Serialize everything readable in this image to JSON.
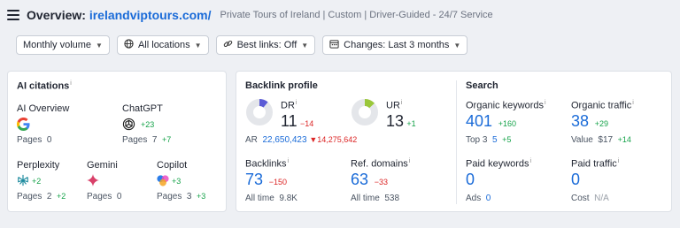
{
  "header": {
    "title_prefix": "Overview:",
    "domain": "irelandviptours.com/",
    "description": "Private Tours of Ireland | Custom | Driver-Guided - 24/7 Service"
  },
  "filters": [
    {
      "label": "Monthly volume",
      "icon": "none"
    },
    {
      "label": "All locations",
      "icon": "globe-icon"
    },
    {
      "label": "Best links: Off",
      "icon": "link-icon"
    },
    {
      "label": "Changes: Last 3 months",
      "icon": "calendar-icon"
    }
  ],
  "ai_citations": {
    "title": "AI citations",
    "ai_overview": {
      "label": "AI Overview",
      "pages_label": "Pages",
      "pages": "0"
    },
    "chatgpt": {
      "label": "ChatGPT",
      "delta": "+23",
      "pages_label": "Pages",
      "pages": "7",
      "pages_delta": "+7"
    },
    "perplexity": {
      "label": "Perplexity",
      "delta": "+2",
      "pages_label": "Pages",
      "pages": "2",
      "pages_delta": "+2"
    },
    "gemini": {
      "label": "Gemini",
      "pages_label": "Pages",
      "pages": "0"
    },
    "copilot": {
      "label": "Copilot",
      "delta": "+3",
      "pages_label": "Pages",
      "pages": "3",
      "pages_delta": "+3"
    }
  },
  "backlink_profile": {
    "title": "Backlink profile",
    "dr": {
      "label": "DR",
      "value": "11",
      "delta": "−14",
      "ring_fraction": 0.11,
      "color": "#5b5bd6"
    },
    "ur": {
      "label": "UR",
      "value": "13",
      "delta": "+1",
      "ring_fraction": 0.13,
      "color": "#9ac73a"
    },
    "ar": {
      "label": "AR",
      "value": "22,650,423",
      "delta": "▼14,275,642"
    },
    "backlinks": {
      "label": "Backlinks",
      "value": "73",
      "delta": "−150",
      "all_time_label": "All time",
      "all_time": "9.8K"
    },
    "ref_domains": {
      "label": "Ref. domains",
      "value": "63",
      "delta": "−33",
      "all_time_label": "All time",
      "all_time": "538"
    }
  },
  "search": {
    "title": "Search",
    "organic_keywords": {
      "label": "Organic keywords",
      "value": "401",
      "delta": "+160",
      "top3_label": "Top 3",
      "top3": "5",
      "top3_delta": "+5"
    },
    "organic_traffic": {
      "label": "Organic traffic",
      "value": "38",
      "delta": "+29",
      "value_label": "Value",
      "value_amount": "$17",
      "value_delta": "+14"
    },
    "paid_keywords": {
      "label": "Paid keywords",
      "value": "0",
      "ads_label": "Ads",
      "ads": "0"
    },
    "paid_traffic": {
      "label": "Paid traffic",
      "value": "0",
      "cost_label": "Cost",
      "cost": "N/A"
    }
  }
}
